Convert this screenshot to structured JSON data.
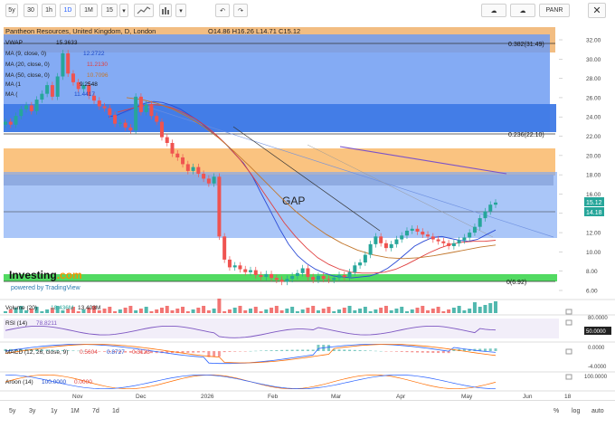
{
  "toolbar": {
    "buttons": [
      "5y",
      "30",
      "1h",
      "1D",
      "1M",
      "15",
      "▾"
    ],
    "symbol_label": "PANR"
  },
  "header": {
    "title": "Pantheon Resources, United Kingdom, D, London",
    "ohlc": "O14.86 H16.26 L14.71 C15.12"
  },
  "indicators": {
    "vwap": {
      "label": "VWAP",
      "value": "15.3633"
    },
    "ma9": {
      "label": "MA (9, close, 0)",
      "value": "12.2722"
    },
    "ma20": {
      "label": "MA (20, close, 0)",
      "value": "11.2130"
    },
    "ma50": {
      "label": "MA (50, close, 0)",
      "value": "10.7096"
    },
    "ma100": {
      "label": "MA (1",
      "value": "9.2548"
    },
    "ma200": {
      "label": "MA (",
      "value": "11.4417"
    }
  },
  "annotations": {
    "gap": "GAP",
    "fib1": "0.382(31.49)",
    "fib2": "0.236(22.10)",
    "fib3": "0(6.92)"
  },
  "branding": {
    "logo": "Investing",
    "logo_suffix": ".com",
    "powered": "powered by TradingView"
  },
  "price_axis": {
    "ticks": [
      "32.00",
      "30.00",
      "28.00",
      "26.00",
      "24.00",
      "22.00",
      "20.00",
      "18.00",
      "16.00",
      "14.00",
      "12.00",
      "10.00",
      "8.00",
      "6.00"
    ],
    "last_price": "15.12",
    "last_price2": "14.18"
  },
  "subpanels": {
    "volume": {
      "label": "Volume (20)",
      "v1": "18.436M",
      "v2": "13.403M",
      "axis": ""
    },
    "rsi": {
      "label": "RSI (14)",
      "value": "78.8211",
      "axis1": "80.0000",
      "axis2": "50.0000"
    },
    "macd": {
      "label": "MACD (12, 26, close, 9)",
      "v1": "0.5604",
      "v2": "0.8727",
      "v3": "0.3123",
      "axis1": "0.0000",
      "axis2": "-4.0000"
    },
    "aroon": {
      "label": "Aroon (14)",
      "v1": "100.0000",
      "v2": "0.0000",
      "axis1": "100.0000"
    }
  },
  "time_axis": [
    "Nov",
    "Dec",
    "2026",
    "Feb",
    "Mar",
    "Apr",
    "May",
    "Jun",
    "18"
  ],
  "bottombar": {
    "ranges": [
      "5y",
      "3y",
      "1y",
      "1M",
      "7d",
      "1d"
    ],
    "right": [
      "%",
      "log",
      "auto"
    ]
  },
  "colors": {
    "up": "#26a69a",
    "down": "#ef5350",
    "zone_blue": "#5b8def",
    "zone_orange": "#f9b86a",
    "zone_green": "#4cd964",
    "ma_purple": "#7b52c8",
    "ma_brown": "#c2772d",
    "ma_red": "#e04040"
  },
  "chart_data": {
    "type": "candlestick",
    "title": "Pantheon Resources, United Kingdom, D, London",
    "ylim": [
      5,
      33
    ],
    "series": [
      {
        "name": "price",
        "values": [
          23.5,
          23.2,
          24.1,
          24.8,
          25.2,
          24.6,
          25.8,
          26.4,
          27.3,
          26.1,
          28.2,
          30.6,
          28.5,
          27.6,
          26.9,
          27.3,
          26.2,
          25.7,
          25.1,
          24.9,
          24.2,
          23.3,
          23.4,
          22.9,
          22.6,
          26.1,
          24.5,
          25.3,
          24.1,
          23.5,
          21.9,
          21.3,
          20.2,
          19.8,
          19.1,
          18.4,
          18.8,
          18.1,
          17.6,
          17.1,
          17.8,
          11.6,
          9.2,
          8.4,
          8.6,
          8.2,
          7.9,
          8.1,
          7.6,
          7.4,
          7.7,
          7.3,
          7.1,
          6.9,
          7.2,
          7.5,
          7.8,
          8.3,
          7.4,
          7.1,
          7.5,
          7.2,
          7.1,
          7.3,
          7.6,
          7.4,
          7.9,
          8.6,
          8.9,
          9.7,
          10.8,
          11.6,
          10.9,
          10.4,
          10.8,
          11.3,
          11.7,
          12.2,
          12.4,
          12.1,
          11.8,
          11.6,
          11.3,
          11.1,
          10.9,
          10.6,
          10.9,
          11.2,
          11.5,
          12.0,
          12.6,
          13.5,
          14.2,
          14.9,
          15.12
        ]
      },
      {
        "name": "MA (9, close, 0)",
        "values": [
          24.0,
          24.2,
          24.6,
          25.0,
          25.4,
          25.6,
          25.5,
          25.2,
          24.8,
          24.2,
          23.6,
          22.8,
          22.1,
          21.2,
          20.2,
          19.2,
          17.8,
          16.0,
          14.2,
          12.4,
          10.8,
          9.6,
          8.8,
          8.2,
          7.8,
          7.5,
          7.4,
          7.3,
          7.4,
          7.5,
          7.8,
          8.3,
          9.0,
          9.8,
          10.6,
          11.1,
          11.5,
          11.6,
          11.4,
          11.2,
          11.1,
          11.3,
          11.8,
          12.27
        ]
      },
      {
        "name": "MA (20, close, 0)",
        "values": [
          24.5,
          24.8,
          25.1,
          25.3,
          25.2,
          24.9,
          24.4,
          23.8,
          23.0,
          22.0,
          20.9,
          19.6,
          18.1,
          16.4,
          14.7,
          13.0,
          11.6,
          10.4,
          9.4,
          8.7,
          8.2,
          7.9,
          7.8,
          7.8,
          7.9,
          8.2,
          8.7,
          9.3,
          9.9,
          10.4,
          10.8,
          11.0,
          11.1,
          11.1,
          11.21
        ]
      },
      {
        "name": "MA (50, close, 0)",
        "values": [
          26.0,
          25.8,
          25.4,
          24.8,
          24.0,
          23.0,
          21.8,
          20.4,
          18.9,
          17.3,
          15.7,
          14.2,
          12.9,
          11.8,
          10.9,
          10.2,
          9.7,
          9.4,
          9.3,
          9.4,
          9.6,
          9.9,
          10.2,
          10.5,
          10.71
        ]
      }
    ],
    "zones": [
      {
        "label": "0.382(31.49)",
        "y": 31.49
      },
      {
        "label": "0.236(22.10)",
        "y": 22.1
      },
      {
        "label": "0(6.92)",
        "y": 6.92
      }
    ]
  }
}
